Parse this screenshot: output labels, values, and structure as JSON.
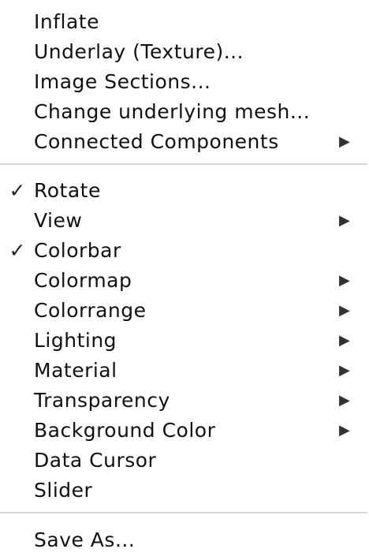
{
  "menu": {
    "items": [
      {
        "label": "Inflate",
        "checked": false,
        "submenu": false
      },
      {
        "label": "Underlay (Texture)...",
        "checked": false,
        "submenu": false
      },
      {
        "label": "Image Sections...",
        "checked": false,
        "submenu": false
      },
      {
        "label": "Change underlying mesh...",
        "checked": false,
        "submenu": false
      },
      {
        "label": "Connected Components",
        "checked": false,
        "submenu": true
      },
      {
        "label": "Rotate",
        "checked": true,
        "submenu": false
      },
      {
        "label": "View",
        "checked": false,
        "submenu": true
      },
      {
        "label": "Colorbar",
        "checked": true,
        "submenu": false
      },
      {
        "label": "Colormap",
        "checked": false,
        "submenu": true
      },
      {
        "label": "Colorrange",
        "checked": false,
        "submenu": true
      },
      {
        "label": "Lighting",
        "checked": false,
        "submenu": true
      },
      {
        "label": "Material",
        "checked": false,
        "submenu": true
      },
      {
        "label": "Transparency",
        "checked": false,
        "submenu": true
      },
      {
        "label": "Background Color",
        "checked": false,
        "submenu": true
      },
      {
        "label": "Data Cursor",
        "checked": false,
        "submenu": false
      },
      {
        "label": "Slider",
        "checked": false,
        "submenu": false
      },
      {
        "label": "Save As...",
        "checked": false,
        "submenu": false
      }
    ]
  },
  "icons": {
    "checkmark": "✓",
    "submenu_arrow": "▶"
  },
  "colors": {
    "background": "#ffffff",
    "separator": "#d6d6d6",
    "text": "#111111"
  }
}
